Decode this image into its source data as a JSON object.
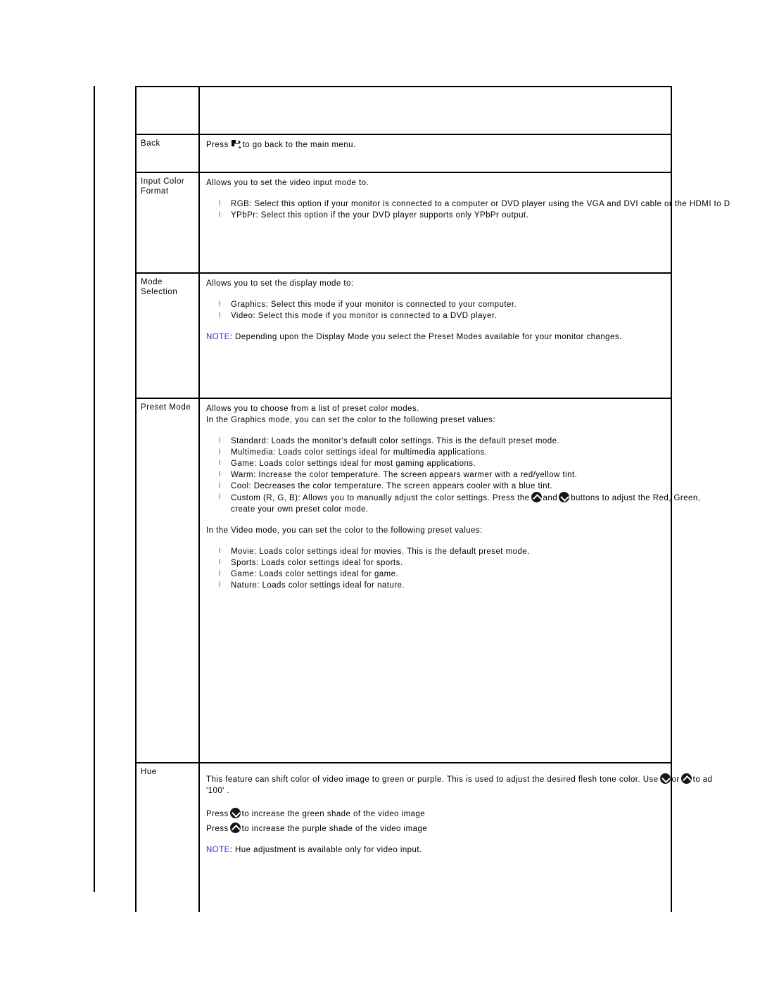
{
  "document": {
    "type": "monitor-osd-settings-reference-table"
  },
  "table": {
    "rows": [
      {
        "label": "",
        "id": "spacer-row"
      },
      {
        "label": "Back",
        "id": "back",
        "press_prefix": "Press",
        "press_suffix": "to go back to the main menu.",
        "icon": "back-arrow-icon"
      },
      {
        "label": "Input Color\nFormat",
        "id": "input-color-format",
        "intro": "Allows you to set the video input mode to.",
        "bullets": [
          "RGB: Select this option if your monitor is connected to a computer or DVD player using the VGA and DVI cable or the HDMI to D",
          "YPbPr: Select this option if the your DVD player supports only YPbPr output."
        ]
      },
      {
        "label": "Mode\nSelection",
        "id": "mode-selection",
        "intro": "Allows you to set the display mode to:",
        "bullets": [
          "Graphics: Select this mode if your monitor is connected to your computer.",
          "Video: Select this mode if you monitor is connected to a DVD player."
        ],
        "note_label": "NOTE",
        "note_text": ": Depending upon the Display Mode you select the Preset Modes available for your monitor changes."
      },
      {
        "label": "Preset Mode",
        "id": "preset-mode",
        "intro": "Allows you to choose from a list of preset color modes.",
        "intro2": "In the Graphics mode, you can set the color to the following preset values:",
        "graphics_bullets": [
          "Standard: Loads the monitor's default color settings. This is the default preset mode.",
          "Multimedia: Loads color settings ideal for multimedia applications.",
          "Game: Loads color settings ideal for most gaming applications.",
          "Warm: Increase the color temperature. The screen appears warmer with a red/yellow tint.",
          "Cool: Decreases the color temperature. The screen appears cooler with a blue tint."
        ],
        "custom_part1": "Custom (R, G, B): Allows you to manually adjust the color settings. Press the",
        "custom_and": "and",
        "custom_part2": "buttons to adjust the Red, Green,",
        "custom_line2": "create your own preset color mode.",
        "video_intro": "In the Video mode, you can set the color to the following preset values:",
        "video_bullets": [
          "Movie: Loads color settings ideal for movies. This is the default preset mode.",
          "Sports: Loads color settings ideal for sports.",
          "Game: Loads color settings ideal for game.",
          "Nature: Loads color settings ideal for nature."
        ]
      },
      {
        "label": "Hue",
        "id": "hue",
        "line1_part1": "This feature can shift color of video image to green or purple. This is used to adjust the desired flesh tone color. Use",
        "line1_or": "or",
        "line1_part2": "to ad",
        "line2": "'100' .",
        "press_green_prefix": "Press",
        "press_green_suffix": "to increase the green shade of the video image",
        "press_purple_prefix": "Press",
        "press_purple_suffix": "to increase the purple shade of the video image",
        "note_label": "NOTE",
        "note_text": ": Hue adjustment is available only for video input."
      }
    ]
  },
  "colors": {
    "note": "#3333cc",
    "rule": "#000000",
    "osd_button": "#151515",
    "page_background": "#ffffff"
  },
  "icons": {
    "back": "back-arrow-icon",
    "up": "chevron-up-button-icon",
    "down": "chevron-down-button-icon"
  }
}
